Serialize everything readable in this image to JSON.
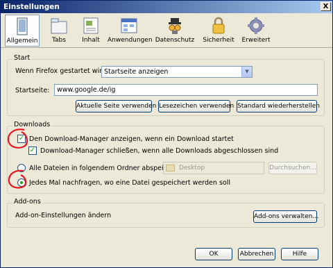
{
  "window": {
    "title": "Einstellungen",
    "close_label": "X"
  },
  "toolbar": {
    "tabs": [
      {
        "label": "Allgemein",
        "icon": "general-icon",
        "selected": true
      },
      {
        "label": "Tabs",
        "icon": "tabs-icon",
        "selected": false
      },
      {
        "label": "Inhalt",
        "icon": "content-icon",
        "selected": false
      },
      {
        "label": "Anwendungen",
        "icon": "applications-icon",
        "selected": false
      },
      {
        "label": "Datenschutz",
        "icon": "privacy-icon",
        "selected": false
      },
      {
        "label": "Sicherheit",
        "icon": "security-icon",
        "selected": false
      },
      {
        "label": "Erweitert",
        "icon": "advanced-icon",
        "selected": false
      }
    ]
  },
  "start": {
    "title": "Start",
    "startup_label": "Wenn Firefox gestartet wird:",
    "startup_value": "Startseite anzeigen",
    "homepage_label": "Startseite:",
    "homepage_value": "www.google.de/ig",
    "btn_current": "Aktuelle Seite verwenden",
    "btn_bookmark": "Lesezeichen verwenden",
    "btn_default": "Standard wiederherstellen"
  },
  "downloads": {
    "title": "Downloads",
    "show_manager_label": "Den Download-Manager anzeigen, wenn ein Download startet",
    "show_manager_checked": true,
    "close_manager_label": "Download-Manager schließen, wenn alle Downloads abgeschlossen sind",
    "close_manager_checked": true,
    "save_to_label": "Alle Dateien in folgendem Ordner abspeichern:",
    "save_to_folder": "Desktop",
    "browse_label": "Durchsuchen...",
    "ask_label": "Jedes Mal nachfragen, wo eine Datei gespeichert werden soll",
    "selected_option": "ask"
  },
  "addons": {
    "title": "Add-ons",
    "settings_label": "Add-on-Einstellungen ändern",
    "manage_label": "Add-ons verwalten..."
  },
  "footer": {
    "ok": "OK",
    "cancel": "Abbrechen",
    "help": "Hilfe"
  },
  "colors": {
    "annotation": "#e8141f",
    "selected_tab_border": "#7f9db9",
    "title_bar": "#0a246a"
  }
}
